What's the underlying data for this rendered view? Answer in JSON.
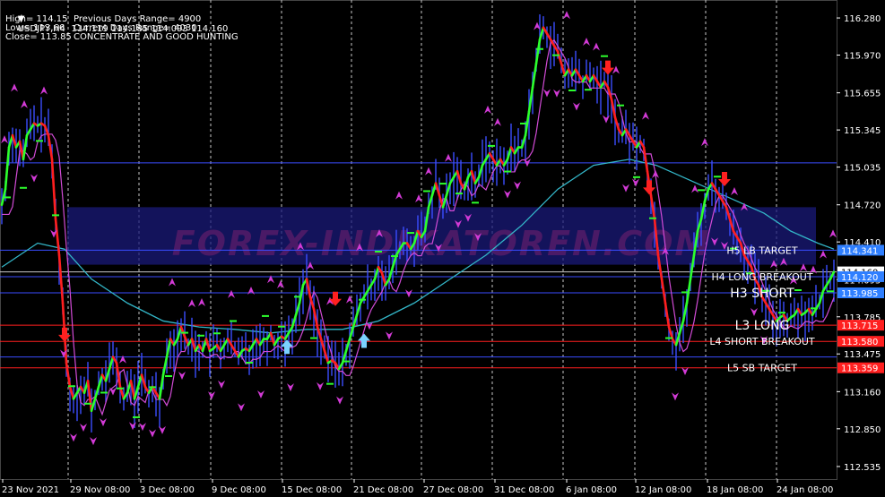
{
  "header": {
    "symbol_line": "USDJPY,H4  114.119 114.185 114.093 114.160",
    "high": "High= 114.15",
    "low": "Low= 113.66",
    "close": "Close= 113.85",
    "prev_range": "Previous Days Range= 4900",
    "cur_range": "Current Days Range= 4030",
    "slogan": "CONCENTRATE AND GOOD HUNTING"
  },
  "watermark": "FOREX-INDIKATOREN.COM",
  "colors": {
    "background": "#000000",
    "grid": "#c8c8c8",
    "price_line": "#3b4dff",
    "up_trend": "#2cff2c",
    "down_trend": "#ff1f1f",
    "ma_cyan": "#33b6c8",
    "ma_magenta": "#d24bd6",
    "arrow_magenta": "#d23ad6",
    "blue_level": "#3a4cff",
    "red_level": "#ff1f1f",
    "signal_red": "#ff2020",
    "signal_cyan": "#7ad3ff"
  },
  "chart_data": {
    "type": "line",
    "symbol": "USDJPY",
    "timeframe": "H4",
    "ylim": [
      112.43,
      116.43
    ],
    "yticks": [
      "116.280",
      "115.970",
      "115.655",
      "115.345",
      "115.035",
      "114.720",
      "114.410",
      "114.095",
      "113.785",
      "113.475",
      "113.160",
      "112.850",
      "112.535"
    ],
    "x_tick_labels": [
      "23 Nov 2021",
      "29 Nov 08:00",
      "3 Dec 08:00",
      "9 Dec 08:00",
      "15 Dec 08:00",
      "21 Dec 08:00",
      "27 Dec 08:00",
      "31 Dec 08:00",
      "6 Jan 08:00",
      "12 Jan 08:00",
      "18 Jan 08:00",
      "24 Jan 08:00"
    ],
    "price_series": [
      [
        0,
        114.72
      ],
      [
        4,
        114.85
      ],
      [
        8,
        115.2
      ],
      [
        12,
        115.3
      ],
      [
        16,
        115.2
      ],
      [
        20,
        115.25
      ],
      [
        24,
        115.1
      ],
      [
        28,
        115.3
      ],
      [
        32,
        115.35
      ],
      [
        36,
        115.4
      ],
      [
        40,
        115.38
      ],
      [
        44,
        115.4
      ],
      [
        48,
        115.38
      ],
      [
        52,
        115.3
      ],
      [
        56,
        115.1
      ],
      [
        60,
        114.6
      ],
      [
        64,
        114.3
      ],
      [
        68,
        113.9
      ],
      [
        72,
        113.4
      ],
      [
        76,
        113.2
      ],
      [
        80,
        113.1
      ],
      [
        84,
        113.15
      ],
      [
        88,
        113.2
      ],
      [
        92,
        113.15
      ],
      [
        96,
        113.25
      ],
      [
        100,
        113.0
      ],
      [
        104,
        113.1
      ],
      [
        108,
        113.2
      ],
      [
        112,
        113.3
      ],
      [
        116,
        113.25
      ],
      [
        120,
        113.35
      ],
      [
        124,
        113.45
      ],
      [
        128,
        113.4
      ],
      [
        132,
        113.2
      ],
      [
        136,
        113.1
      ],
      [
        140,
        113.15
      ],
      [
        144,
        113.25
      ],
      [
        148,
        113.1
      ],
      [
        152,
        113.2
      ],
      [
        156,
        113.3
      ],
      [
        160,
        113.2
      ],
      [
        164,
        113.15
      ],
      [
        168,
        113.2
      ],
      [
        172,
        113.15
      ],
      [
        176,
        113.1
      ],
      [
        180,
        113.3
      ],
      [
        184,
        113.45
      ],
      [
        188,
        113.6
      ],
      [
        192,
        113.55
      ],
      [
        196,
        113.6
      ],
      [
        200,
        113.7
      ],
      [
        204,
        113.62
      ],
      [
        208,
        113.55
      ],
      [
        212,
        113.6
      ],
      [
        216,
        113.5
      ],
      [
        220,
        113.55
      ],
      [
        224,
        113.5
      ],
      [
        228,
        113.6
      ],
      [
        232,
        113.5
      ],
      [
        236,
        113.52
      ],
      [
        240,
        113.55
      ],
      [
        244,
        113.5
      ],
      [
        248,
        113.55
      ],
      [
        252,
        113.6
      ],
      [
        256,
        113.55
      ],
      [
        260,
        113.5
      ],
      [
        264,
        113.45
      ],
      [
        268,
        113.5
      ],
      [
        272,
        113.52
      ],
      [
        276,
        113.5
      ],
      [
        280,
        113.55
      ],
      [
        284,
        113.6
      ],
      [
        288,
        113.55
      ],
      [
        292,
        113.6
      ],
      [
        296,
        113.6
      ],
      [
        300,
        113.65
      ],
      [
        304,
        113.55
      ],
      [
        308,
        113.6
      ],
      [
        312,
        113.62
      ],
      [
        316,
        113.6
      ],
      [
        320,
        113.65
      ],
      [
        324,
        113.7
      ],
      [
        328,
        113.8
      ],
      [
        332,
        113.9
      ],
      [
        336,
        114.05
      ],
      [
        340,
        114.1
      ],
      [
        344,
        113.95
      ],
      [
        348,
        113.85
      ],
      [
        352,
        113.7
      ],
      [
        356,
        113.6
      ],
      [
        360,
        113.5
      ],
      [
        364,
        113.4
      ],
      [
        368,
        113.42
      ],
      [
        372,
        113.4
      ],
      [
        376,
        113.35
      ],
      [
        380,
        113.4
      ],
      [
        384,
        113.5
      ],
      [
        388,
        113.6
      ],
      [
        392,
        113.7
      ],
      [
        396,
        113.8
      ],
      [
        400,
        113.9
      ],
      [
        404,
        113.95
      ],
      [
        408,
        114.0
      ],
      [
        412,
        114.05
      ],
      [
        416,
        114.1
      ],
      [
        420,
        114.2
      ],
      [
        424,
        114.15
      ],
      [
        428,
        114.05
      ],
      [
        432,
        114.1
      ],
      [
        436,
        114.2
      ],
      [
        440,
        114.3
      ],
      [
        444,
        114.35
      ],
      [
        448,
        114.4
      ],
      [
        452,
        114.4
      ],
      [
        456,
        114.35
      ],
      [
        460,
        114.4
      ],
      [
        464,
        114.5
      ],
      [
        468,
        114.45
      ],
      [
        472,
        114.5
      ],
      [
        476,
        114.7
      ],
      [
        480,
        114.8
      ],
      [
        484,
        114.9
      ],
      [
        488,
        114.8
      ],
      [
        492,
        114.7
      ],
      [
        496,
        114.8
      ],
      [
        500,
        114.9
      ],
      [
        504,
        114.95
      ],
      [
        508,
        115.0
      ],
      [
        512,
        114.9
      ],
      [
        516,
        114.85
      ],
      [
        520,
        114.95
      ],
      [
        524,
        115.0
      ],
      [
        528,
        114.9
      ],
      [
        532,
        114.95
      ],
      [
        536,
        115.05
      ],
      [
        540,
        115.1
      ],
      [
        544,
        115.15
      ],
      [
        548,
        115.1
      ],
      [
        552,
        115.05
      ],
      [
        556,
        115.1
      ],
      [
        560,
        115.05
      ],
      [
        564,
        115.1
      ],
      [
        568,
        115.2
      ],
      [
        572,
        115.15
      ],
      [
        576,
        115.2
      ],
      [
        580,
        115.2
      ],
      [
        584,
        115.3
      ],
      [
        588,
        115.5
      ],
      [
        592,
        115.7
      ],
      [
        596,
        115.9
      ],
      [
        600,
        116.1
      ],
      [
        604,
        116.2
      ],
      [
        608,
        116.15
      ],
      [
        612,
        116.1
      ],
      [
        616,
        116.05
      ],
      [
        620,
        116.0
      ],
      [
        624,
        115.9
      ],
      [
        628,
        115.8
      ],
      [
        632,
        115.85
      ],
      [
        636,
        115.8
      ],
      [
        640,
        115.85
      ],
      [
        644,
        115.8
      ],
      [
        648,
        115.75
      ],
      [
        652,
        115.8
      ],
      [
        656,
        115.75
      ],
      [
        660,
        115.8
      ],
      [
        664,
        115.75
      ],
      [
        668,
        115.7
      ],
      [
        672,
        115.75
      ],
      [
        676,
        115.7
      ],
      [
        680,
        115.6
      ],
      [
        684,
        115.45
      ],
      [
        688,
        115.35
      ],
      [
        692,
        115.3
      ],
      [
        696,
        115.35
      ],
      [
        700,
        115.3
      ],
      [
        704,
        115.25
      ],
      [
        708,
        115.2
      ],
      [
        712,
        115.25
      ],
      [
        716,
        115.2
      ],
      [
        720,
        115.0
      ],
      [
        724,
        114.8
      ],
      [
        728,
        114.6
      ],
      [
        732,
        114.3
      ],
      [
        736,
        114.1
      ],
      [
        740,
        113.9
      ],
      [
        744,
        113.7
      ],
      [
        748,
        113.6
      ],
      [
        752,
        113.55
      ],
      [
        756,
        113.65
      ],
      [
        760,
        113.75
      ],
      [
        764,
        113.9
      ],
      [
        768,
        114.1
      ],
      [
        772,
        114.3
      ],
      [
        776,
        114.5
      ],
      [
        780,
        114.6
      ],
      [
        784,
        114.75
      ],
      [
        788,
        114.85
      ],
      [
        792,
        114.9
      ],
      [
        796,
        114.85
      ],
      [
        800,
        114.8
      ],
      [
        804,
        114.75
      ],
      [
        808,
        114.7
      ],
      [
        812,
        114.6
      ],
      [
        816,
        114.5
      ],
      [
        820,
        114.45
      ],
      [
        824,
        114.4
      ],
      [
        828,
        114.3
      ],
      [
        832,
        114.25
      ],
      [
        836,
        114.2
      ],
      [
        840,
        114.1
      ],
      [
        844,
        114.05
      ],
      [
        848,
        113.95
      ],
      [
        852,
        113.9
      ],
      [
        856,
        113.85
      ],
      [
        860,
        113.8
      ],
      [
        864,
        113.75
      ],
      [
        868,
        113.78
      ],
      [
        872,
        113.8
      ],
      [
        876,
        113.75
      ],
      [
        880,
        113.78
      ],
      [
        884,
        113.8
      ],
      [
        888,
        113.85
      ],
      [
        892,
        113.8
      ],
      [
        896,
        113.82
      ],
      [
        900,
        113.85
      ],
      [
        904,
        113.8
      ],
      [
        908,
        113.85
      ],
      [
        912,
        113.9
      ],
      [
        916,
        114.0
      ],
      [
        920,
        114.05
      ],
      [
        924,
        114.1
      ],
      [
        928,
        114.16
      ]
    ],
    "ma_cyan": [
      [
        0,
        114.2
      ],
      [
        40,
        114.4
      ],
      [
        70,
        114.35
      ],
      [
        100,
        114.1
      ],
      [
        140,
        113.9
      ],
      [
        180,
        113.75
      ],
      [
        220,
        113.7
      ],
      [
        260,
        113.68
      ],
      [
        300,
        113.65
      ],
      [
        340,
        113.68
      ],
      [
        380,
        113.68
      ],
      [
        420,
        113.75
      ],
      [
        460,
        113.9
      ],
      [
        500,
        114.1
      ],
      [
        540,
        114.3
      ],
      [
        580,
        114.55
      ],
      [
        620,
        114.85
      ],
      [
        660,
        115.05
      ],
      [
        700,
        115.1
      ],
      [
        730,
        115.05
      ],
      [
        760,
        114.95
      ],
      [
        790,
        114.85
      ],
      [
        820,
        114.75
      ],
      [
        850,
        114.65
      ],
      [
        880,
        114.5
      ],
      [
        910,
        114.4
      ],
      [
        928,
        114.35
      ]
    ],
    "levels": [
      {
        "price": 115.07,
        "color": "#3a4cff"
      },
      {
        "price": 114.341,
        "label": "H5 LB TARGET",
        "axis": "114.341",
        "axis_bg": "#2f7fff",
        "color": "#3a4cff"
      },
      {
        "price": 114.16,
        "axis": "114.160",
        "axis_bg": "#ffffff",
        "axis_fg": "#000000",
        "color": "#c8c8c8"
      },
      {
        "price": 114.12,
        "label": "H4 LONG BREAKOUT",
        "axis": "114.120",
        "axis_bg": "#2f7fff",
        "color": "#3a4cff"
      },
      {
        "price": 113.985,
        "label": "H3 SHORT",
        "axis": "113.985",
        "axis_bg": "#2f7fff",
        "color": "#3a4cff",
        "big": true
      },
      {
        "price": 113.715,
        "label": "L3 LONG",
        "axis": "113.715",
        "axis_bg": "#ff1f1f",
        "color": "#ff1f1f",
        "big": true
      },
      {
        "price": 113.58,
        "label": "L4 SHORT BREAKOUT",
        "axis": "113.580",
        "axis_bg": "#ff1f1f",
        "color": "#ff1f1f"
      },
      {
        "price": 113.45,
        "color": "#3a4cff"
      },
      {
        "price": 113.359,
        "label": "L5 SB TARGET",
        "axis": "113.359",
        "axis_bg": "#ff1f1f",
        "color": "#ff1f1f"
      }
    ],
    "signals": [
      {
        "t": 70,
        "price": 113.62,
        "dir": "down",
        "color": "#ff2020"
      },
      {
        "t": 318,
        "price": 113.55,
        "dir": "up",
        "color": "#7ad3ff"
      },
      {
        "t": 372,
        "price": 113.92,
        "dir": "down",
        "color": "#ff2020"
      },
      {
        "t": 404,
        "price": 113.6,
        "dir": "up",
        "color": "#7ad3ff"
      },
      {
        "t": 676,
        "price": 115.85,
        "dir": "down",
        "color": "#ff2020"
      },
      {
        "t": 722,
        "price": 114.85,
        "dir": "down",
        "color": "#ff2020"
      },
      {
        "t": 806,
        "price": 114.92,
        "dir": "down",
        "color": "#ff2020"
      }
    ],
    "grid": true
  }
}
